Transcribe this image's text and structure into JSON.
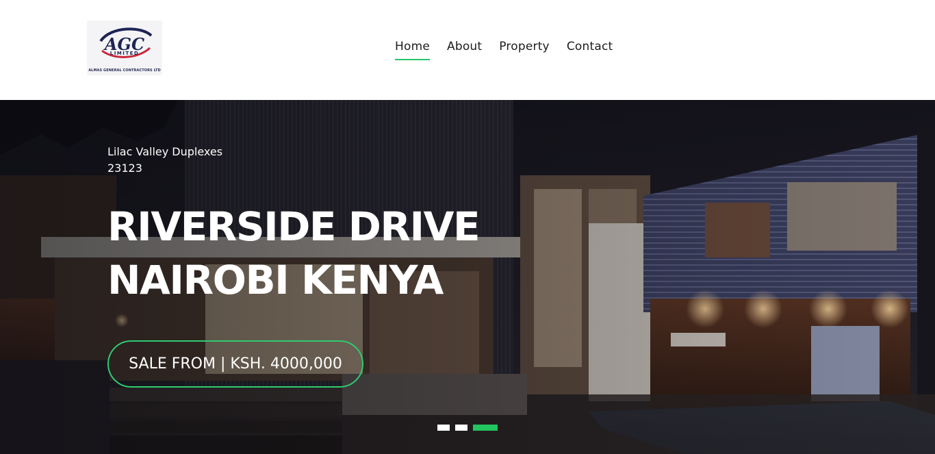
{
  "brand": {
    "logo_text": "AGC",
    "logo_subtext": "LIMITED",
    "logo_caption": "ALMAS GENERAL CONTRACTORS LTD"
  },
  "nav": {
    "items": [
      {
        "label": "Home",
        "active": true
      },
      {
        "label": "About",
        "active": false
      },
      {
        "label": "Property",
        "active": false
      },
      {
        "label": "Contact",
        "active": false
      }
    ]
  },
  "hero": {
    "subtitle_line1": "Lilac Valley Duplexes",
    "subtitle_line2": "23123",
    "title_line1": "RIVERSIDE DRIVE",
    "title_line2": "NAIROBI KENYA",
    "price_label": "SALE FROM | KSH. 4000,000",
    "slides_total": 3,
    "active_slide": 3
  },
  "colors": {
    "accent": "#27c46a",
    "header_bg": "#ffffff",
    "hero_text": "#ffffff"
  }
}
